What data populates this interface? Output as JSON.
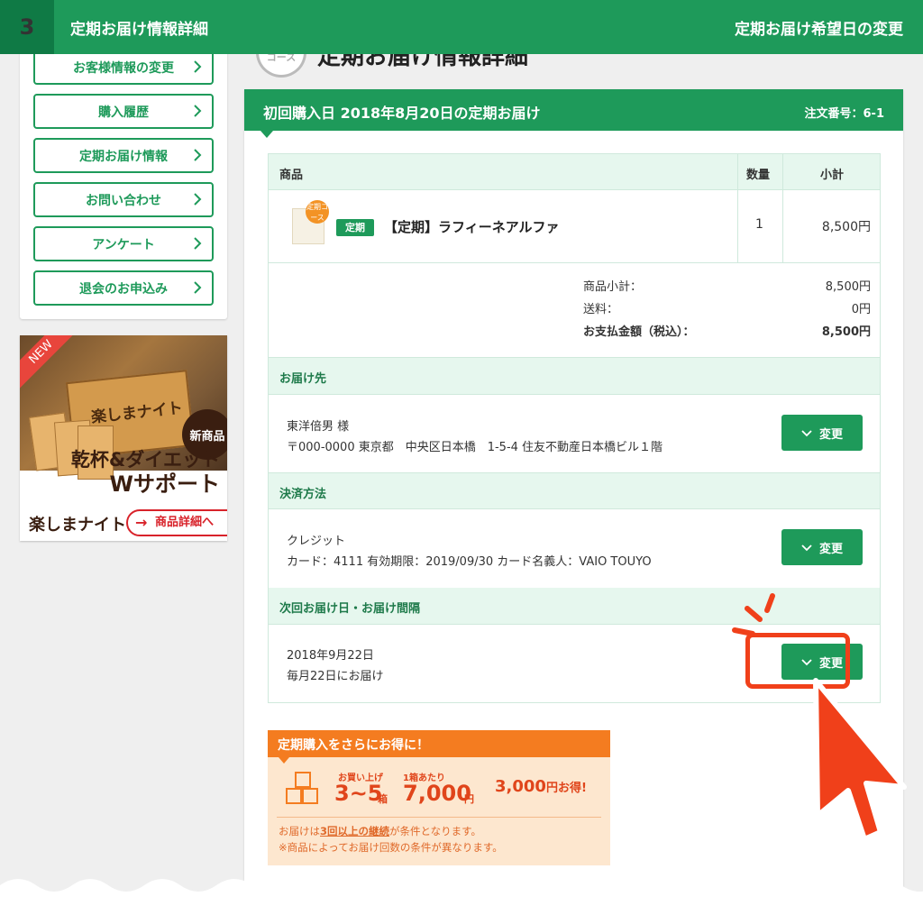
{
  "header": {
    "step": "3",
    "title": "定期お届け情報詳細",
    "right_label": "定期お届け希望日の変更"
  },
  "sidebar": {
    "items": [
      {
        "label": "お客様情報の変更"
      },
      {
        "label": "購入履歴"
      },
      {
        "label": "定期お届け情報"
      },
      {
        "label": "お問い合わせ"
      },
      {
        "label": "アンケート"
      },
      {
        "label": "退会のお申込み"
      }
    ]
  },
  "banner": {
    "new": "NEW",
    "box_text": "楽しまナイト",
    "new_product": "新商品",
    "headline1": "乾杯&ダイエット",
    "headline2": "Wサポート",
    "logo": "楽しまナイト",
    "detail_button": "商品詳細へ"
  },
  "page_heading": {
    "badge": "コース",
    "text": "定期お届け情報詳細"
  },
  "order": {
    "title": "初回購入日 2018年8月20日の定期お届け",
    "order_number": "注文番号：6-1",
    "columns": {
      "product": "商品",
      "qty": "数量",
      "subtotal": "小計"
    },
    "product": {
      "thumb_badge": "定期コース",
      "tag": "定期",
      "name": "【定期】ラフィーネアルファ",
      "qty": "1",
      "subtotal": "8,500円"
    },
    "totals": [
      {
        "label": "商品小計：",
        "value": "8,500円"
      },
      {
        "label": "送料：",
        "value": "0円"
      },
      {
        "label": "お支払金額（税込）：",
        "value": "8,500円"
      }
    ],
    "shipping": {
      "header": "お届け先",
      "name": "東洋倍男 様",
      "address": "〒000-0000 東京都　中央区日本橋　1-5-4 住友不動産日本橋ビル１階",
      "button": "変更"
    },
    "payment": {
      "header": "決済方法",
      "method": "クレジット",
      "card": "カード：4111 有効期限：2019/09/30 カード名義人：VAIO TOUYO",
      "button": "変更"
    },
    "next_delivery": {
      "header": "次回お届け日・お届け間隔",
      "date": "2018年9月22日",
      "interval": "毎月22日にお届け",
      "button": "変更"
    }
  },
  "promo": {
    "title": "定期購入をさらにお得に！",
    "label_buy": "お買い上げ",
    "boxes_qty": "3~5",
    "boxes_unit": "箱",
    "label_per_box": "1箱あたり",
    "price": "7,000",
    "price_unit": "円",
    "savings": "3,000",
    "savings_unit": "円お得!",
    "note1_pre": "お届けは",
    "note1_em": "3回以上の継続",
    "note1_post": "が条件となります。",
    "note2": "※商品によってお届け回数の条件が異なります。"
  },
  "colors": {
    "brand_green": "#1e9a5a",
    "light_green": "#e6f7ee",
    "accent_orange": "#f47c20",
    "highlight_red": "#f0401a"
  }
}
